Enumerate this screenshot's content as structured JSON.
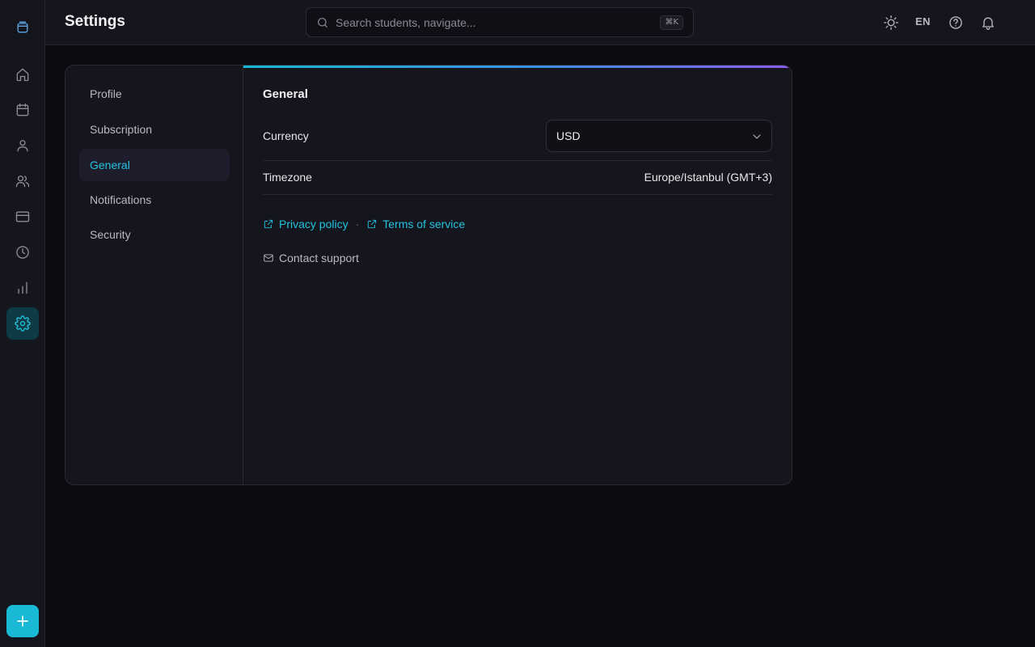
{
  "header": {
    "title": "Settings",
    "search_placeholder": "Search students, navigate...",
    "search_shortcut": "⌘K",
    "language": "EN"
  },
  "sidebar": {
    "items": [
      {
        "name": "logo",
        "icon": "box-logo-icon"
      },
      {
        "name": "home",
        "icon": "home-icon"
      },
      {
        "name": "calendar",
        "icon": "calendar-icon"
      },
      {
        "name": "student",
        "icon": "user-icon"
      },
      {
        "name": "users",
        "icon": "users-icon"
      },
      {
        "name": "payments",
        "icon": "credit-card-icon"
      },
      {
        "name": "history",
        "icon": "clock-icon"
      },
      {
        "name": "reports",
        "icon": "bar-chart-icon"
      },
      {
        "name": "settings",
        "icon": "gear-icon",
        "active": true
      }
    ],
    "add_icon": "plus-icon"
  },
  "settings_nav": {
    "items": [
      {
        "label": "Profile"
      },
      {
        "label": "Subscription"
      },
      {
        "label": "General",
        "active": true
      },
      {
        "label": "Notifications"
      },
      {
        "label": "Security"
      }
    ]
  },
  "general": {
    "title": "General",
    "currency_label": "Currency",
    "currency_value": "USD",
    "timezone_label": "Timezone",
    "timezone_value": "Europe/Istanbul (GMT+3)",
    "privacy_label": "Privacy policy",
    "separator": "·",
    "terms_label": "Terms of service",
    "contact_label": "Contact support"
  },
  "colors": {
    "accent": "#22c3e0",
    "background": "#0c0b10",
    "panel": "#15151d",
    "gradient_end": "#8b5cf6"
  }
}
